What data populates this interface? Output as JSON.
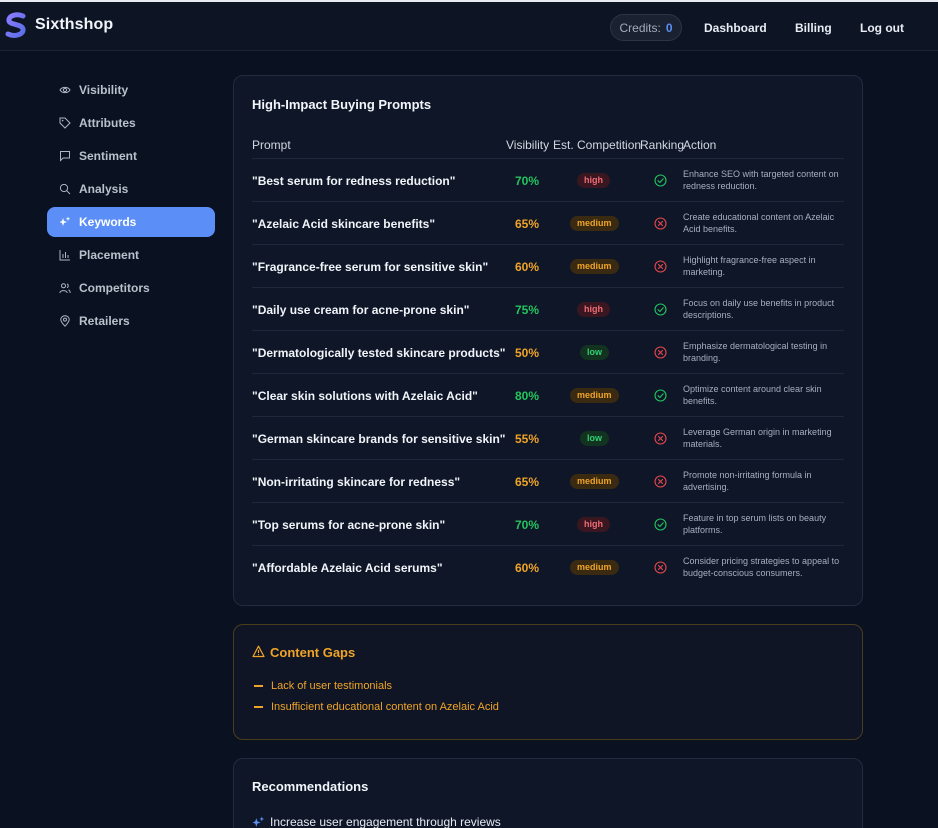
{
  "brand": {
    "name": "Sixthshop"
  },
  "header": {
    "credits_label": "Credits:",
    "credits_value": "0",
    "nav": [
      "Dashboard",
      "Billing",
      "Log out"
    ]
  },
  "sidebar": {
    "items": [
      {
        "label": "Visibility",
        "icon": "eye-icon"
      },
      {
        "label": "Attributes",
        "icon": "tag-icon"
      },
      {
        "label": "Sentiment",
        "icon": "message-square-icon"
      },
      {
        "label": "Analysis",
        "icon": "search-icon"
      },
      {
        "label": "Keywords",
        "icon": "sparkles-icon",
        "active": true
      },
      {
        "label": "Placement",
        "icon": "bar-chart-icon"
      },
      {
        "label": "Competitors",
        "icon": "users-icon"
      },
      {
        "label": "Retailers",
        "icon": "map-pin-icon"
      }
    ]
  },
  "prompts_card": {
    "title": "High-Impact Buying Prompts",
    "columns": [
      "Prompt",
      "Visibility",
      "Est. Competition",
      "Ranking",
      "Action"
    ],
    "rows": [
      {
        "prompt": "\"Best serum for redness reduction\"",
        "visibility": "70%",
        "competition": "high",
        "ranking": "check",
        "action": "Enhance SEO with targeted content on redness reduction."
      },
      {
        "prompt": "\"Azelaic Acid skincare benefits\"",
        "visibility": "65%",
        "competition": "medium",
        "ranking": "cross",
        "action": "Create educational content on Azelaic Acid benefits."
      },
      {
        "prompt": "\"Fragrance-free serum for sensitive skin\"",
        "visibility": "60%",
        "competition": "medium",
        "ranking": "cross",
        "action": "Highlight fragrance-free aspect in marketing."
      },
      {
        "prompt": "\"Daily use cream for acne-prone skin\"",
        "visibility": "75%",
        "competition": "high",
        "ranking": "check",
        "action": "Focus on daily use benefits in product descriptions."
      },
      {
        "prompt": "\"Dermatologically tested skincare products\"",
        "visibility": "50%",
        "competition": "low",
        "ranking": "cross",
        "action": "Emphasize dermatological testing in branding."
      },
      {
        "prompt": "\"Clear skin solutions with Azelaic Acid\"",
        "visibility": "80%",
        "competition": "medium",
        "ranking": "check",
        "action": "Optimize content around clear skin benefits."
      },
      {
        "prompt": "\"German skincare brands for sensitive skin\"",
        "visibility": "55%",
        "competition": "low",
        "ranking": "cross",
        "action": "Leverage German origin in marketing materials."
      },
      {
        "prompt": "\"Non-irritating skincare for redness\"",
        "visibility": "65%",
        "competition": "medium",
        "ranking": "cross",
        "action": "Promote non-irritating formula in advertising."
      },
      {
        "prompt": "\"Top serums for acne-prone skin\"",
        "visibility": "70%",
        "competition": "high",
        "ranking": "check",
        "action": "Feature in top serum lists on beauty platforms."
      },
      {
        "prompt": "\"Affordable Azelaic Acid serums\"",
        "visibility": "60%",
        "competition": "medium",
        "ranking": "cross",
        "action": "Consider pricing strategies to appeal to budget-conscious consumers."
      }
    ]
  },
  "content_gaps": {
    "title": "Content Gaps",
    "items": [
      "Lack of user testimonials",
      "Insufficient educational content on Azelaic Acid"
    ]
  },
  "recommendations": {
    "title": "Recommendations",
    "items": [
      "Increase user engagement through reviews"
    ]
  },
  "colors": {
    "accent": "#5b8ff7",
    "positive": "#22c55e",
    "warning": "#f0a427",
    "negative": "#e5484d"
  }
}
